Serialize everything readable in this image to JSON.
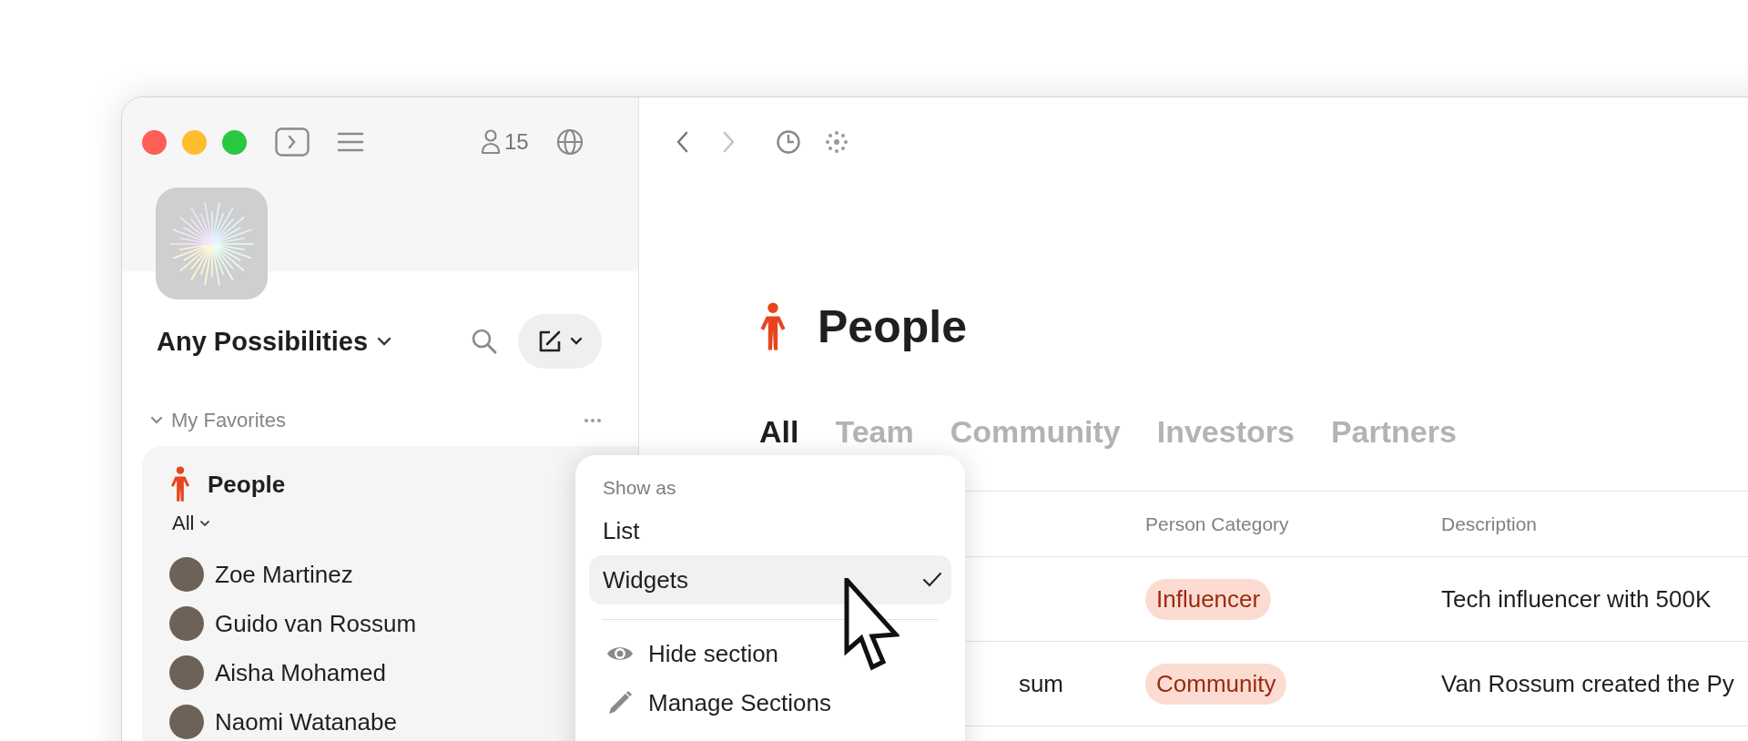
{
  "sidebar": {
    "member_count": "15",
    "workspace": {
      "name": "Any Possibilities"
    },
    "section": {
      "title": "My Favorites",
      "expanded": true
    },
    "favorite": {
      "title": "People",
      "filter": "All",
      "people": [
        {
          "name": "Zoe Martinez"
        },
        {
          "name": "Guido van Rossum"
        },
        {
          "name": "Aisha Mohamed"
        },
        {
          "name": "Naomi Watanabe"
        }
      ]
    }
  },
  "toolbar": {
    "nav": [
      {
        "kind": "back",
        "disabled": false
      },
      {
        "kind": "forward",
        "disabled": true
      }
    ]
  },
  "page": {
    "title": "People",
    "tabs": [
      {
        "label": "All",
        "selected": true
      },
      {
        "label": "Team",
        "selected": false
      },
      {
        "label": "Community",
        "selected": false
      },
      {
        "label": "Investors",
        "selected": false
      },
      {
        "label": "Partners",
        "selected": false
      }
    ],
    "table": {
      "columns": [
        "Person Category",
        "Description"
      ],
      "rows": [
        {
          "category": "Influencer",
          "description": "Tech influencer with 500K"
        },
        {
          "column_1": "sum",
          "category": "Community",
          "description": "Van Rossum created the Py"
        }
      ]
    }
  },
  "menu": {
    "heading": "Show as",
    "options": [
      {
        "label": "List",
        "selected": false
      },
      {
        "label": "Widgets",
        "selected": true
      }
    ],
    "actions": [
      {
        "kind": "hide",
        "label": "Hide section"
      },
      {
        "kind": "edit",
        "label": "Manage Sections"
      }
    ]
  }
}
